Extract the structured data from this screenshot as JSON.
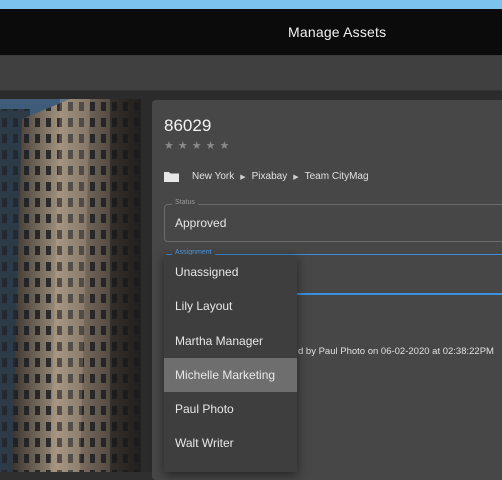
{
  "header": {
    "title": "Manage Assets"
  },
  "asset": {
    "id": "86029",
    "rating": "★★★★★",
    "breadcrumb": [
      "New York",
      "Pixabay",
      "Team CityMag"
    ]
  },
  "status_field": {
    "legend": "Status",
    "value": "Approved"
  },
  "assignment_field": {
    "legend": "Assignment"
  },
  "history": {
    "text": "d by Paul Photo on 06-02-2020 at 02:38:22PM"
  },
  "assignment_menu": {
    "items": [
      "Unassigned",
      "Lily Layout",
      "Martha Manager",
      "Michelle Marketing",
      "Paul Photo",
      "Walt Writer"
    ],
    "selected_index": 3
  },
  "colors": {
    "accent": "#3b8ee0",
    "topbar": "#0b0b0b",
    "panel": "#474747"
  }
}
